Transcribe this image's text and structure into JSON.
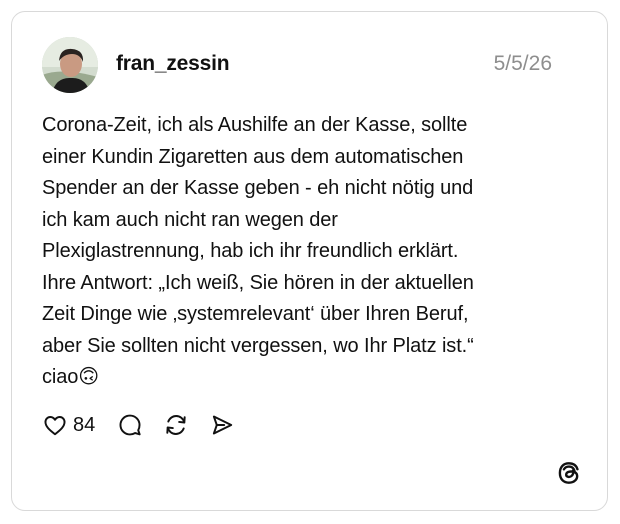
{
  "post": {
    "username": "fran_zessin",
    "date": "5/5/26",
    "text": "Corona-Zeit, ich als Aushilfe an der Kasse, sollte\neiner Kundin Zigaretten aus dem automatischen\nSpender an der Kasse geben - eh nicht nötig und\nich kam auch nicht ran wegen der\nPlexiglastrennung, hab ich ihr freundlich erklärt.\nIhre Antwort: „Ich weiß, Sie hören in der aktuellen\nZeit Dinge wie ‚systemrelevant‘ über Ihren Beruf,\naber Sie sollten nicht vergessen, wo Ihr Platz ist.“\nciao🙃"
  },
  "actions": {
    "like_count": "84",
    "icons": [
      "heart-icon",
      "comment-icon",
      "repost-icon",
      "share-icon"
    ]
  },
  "branding": {
    "logo": "threads-logo-icon"
  },
  "colors": {
    "text": "#111111",
    "muted": "#8e8e8e",
    "border": "#d9d9d9"
  }
}
